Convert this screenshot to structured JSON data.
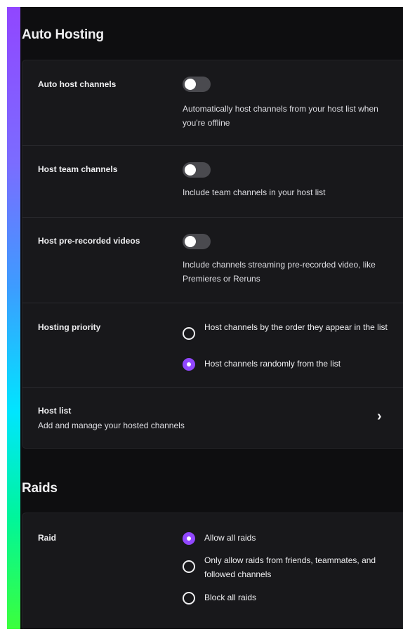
{
  "auto_hosting": {
    "title": "Auto Hosting",
    "auto_host": {
      "label": "Auto host channels",
      "description": "Automatically host channels from your host list when you're offline",
      "enabled": false
    },
    "host_team": {
      "label": "Host team channels",
      "description": "Include team channels in your host list",
      "enabled": false
    },
    "host_prerecorded": {
      "label": "Host pre-recorded videos",
      "description": "Include channels streaming pre-recorded video, like Premieres or Reruns",
      "enabled": false
    },
    "hosting_priority": {
      "label": "Hosting priority",
      "options": [
        {
          "label": "Host channels by the order they appear in the list",
          "checked": false
        },
        {
          "label": "Host channels randomly from the list",
          "checked": true
        }
      ]
    },
    "host_list": {
      "label": "Host list",
      "subtitle": "Add and manage your hosted channels",
      "chevron": "›"
    }
  },
  "raids": {
    "title": "Raids",
    "raid": {
      "label": "Raid",
      "options": [
        {
          "label": "Allow all raids",
          "checked": true
        },
        {
          "label": "Only allow raids from friends, teammates, and followed channels",
          "checked": false
        },
        {
          "label": "Block all raids",
          "checked": false
        }
      ]
    }
  },
  "colors": {
    "accent": "#9147ff",
    "background": "#0e0e10",
    "card": "#18181b",
    "toggle_off": "#4a4a4f"
  }
}
